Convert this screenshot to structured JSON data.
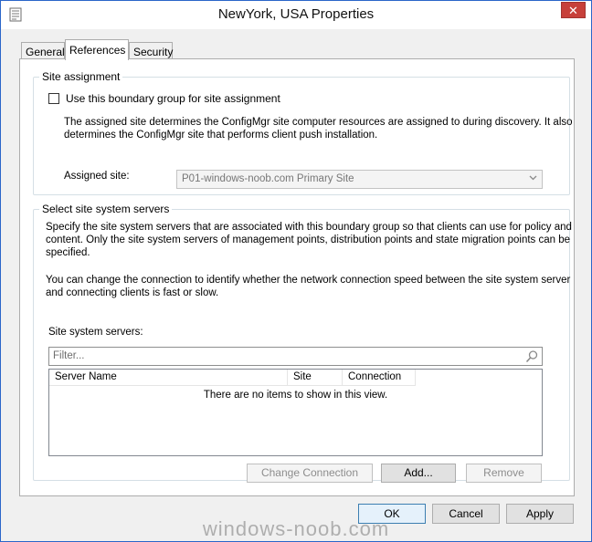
{
  "window": {
    "title": "NewYork, USA Properties",
    "close_label": "✕"
  },
  "tabs": [
    {
      "label": "General"
    },
    {
      "label": "References"
    },
    {
      "label": "Security"
    }
  ],
  "site_assignment": {
    "group_title": "Site assignment",
    "checkbox_label": "Use this boundary group for site assignment",
    "checkbox_checked": false,
    "description_line1": "The assigned site determines the ConfigMgr site computer resources are assigned to during discovery. It also",
    "description_line2": "determines the ConfigMgr site that performs client push installation.",
    "assigned_site_label": "Assigned site:",
    "assigned_site_value": "P01-windows-noob.com Primary Site"
  },
  "site_servers": {
    "group_title": "Select site system servers",
    "description1_line1": "Specify the site system servers that are associated with this boundary group so that clients can use for policy and",
    "description1_line2": "content. Only the site system servers of management points, distribution points and state migration points can be",
    "description1_line3": "specified.",
    "description2_line1": "You can change the connection to identify whether the network connection speed between the site system server",
    "description2_line2": "and connecting clients is fast or slow.",
    "list_label": "Site system servers:",
    "filter_placeholder": "Filter...",
    "columns": [
      "Server Name",
      "Site",
      "Connection"
    ],
    "empty_message": "There are no items to show in this view.",
    "change_connection_label": "Change Connection",
    "add_label": "Add...",
    "remove_label": "Remove"
  },
  "footer": {
    "ok_label": "OK",
    "cancel_label": "Cancel",
    "apply_label": "Apply"
  },
  "watermark": "windows-noob.com",
  "icons": {
    "title": "properties-document-icon",
    "filter": "magnifier-icon",
    "dropdown": "chevron-down-icon"
  }
}
